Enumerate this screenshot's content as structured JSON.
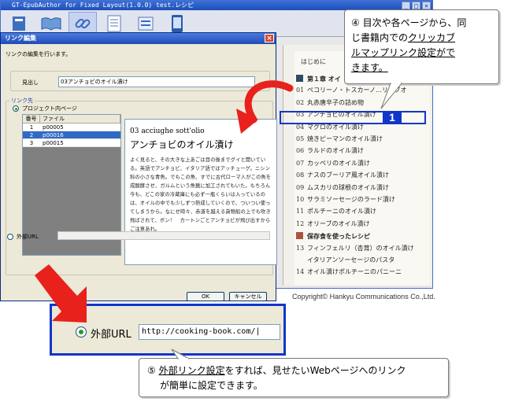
{
  "app": {
    "title": "GT-EpubAuthor for Fixed Layout(1.0.0) test.レシピ",
    "window_buttons": [
      "_",
      "□",
      "×"
    ],
    "toolbar_icons": [
      "book-icon",
      "open-book-icon",
      "link-icon",
      "document-icon",
      "list-icon",
      "device-icon"
    ]
  },
  "toc": {
    "heading": "はじめに",
    "rows": [
      {
        "num": "",
        "label": "第１章 オイ",
        "chapter": true,
        "square": "#2e4a6a"
      },
      {
        "num": "01",
        "label": "ペコリーノ・トスカーノ…リーブオ"
      },
      {
        "num": "02",
        "label": "丸赤唐辛子の詰め物"
      },
      {
        "num": "03",
        "label": "アンチョビのオイル漬け"
      },
      {
        "num": "04",
        "label": "マグロのオイル漬け"
      },
      {
        "num": "05",
        "label": "焼きピーマンのオイル漬け"
      },
      {
        "num": "06",
        "label": "ラルドのオイル漬け"
      },
      {
        "num": "07",
        "label": "カッペリのオイル漬け"
      },
      {
        "num": "08",
        "label": "ナスのブーリア風オイル漬け"
      },
      {
        "num": "09",
        "label": "ムスカリの球根のオイル漬け"
      },
      {
        "num": "10",
        "label": "サラミソーセージのラード漬け"
      },
      {
        "num": "11",
        "label": "ポルチーニのオイル漬け"
      },
      {
        "num": "12",
        "label": "オリーブのオイル漬け"
      },
      {
        "num": "",
        "label": "保存食を使ったレシピ",
        "chapter": true,
        "square": "#a8553a"
      },
      {
        "num": "13",
        "label": "フィンフェルリ（杏茸）のオイル漬け"
      },
      {
        "num": "",
        "label": "イタリアンソーセージのパスタ"
      },
      {
        "num": "14",
        "label": "オイル漬けポルチーニのパニーニ"
      }
    ]
  },
  "highlight": {
    "badge": "1"
  },
  "dialog": {
    "title": "リンク編集",
    "close": "×",
    "description": "リンクの編集を行います。",
    "name_label": "見出し",
    "name_value": "03アンチョビのオイル漬け",
    "link_group_label": "リンク先",
    "internal_radio": "プロジェクト内ページ",
    "table": {
      "headers": [
        "番号",
        "ファイル"
      ],
      "rows": [
        [
          "1",
          "p00005"
        ],
        [
          "2",
          "p00016"
        ],
        [
          "3",
          "p00015"
        ]
      ],
      "selected": 1
    },
    "preview": {
      "number": "03  acciughe sott'olio",
      "title": "アンチョビのオイル漬け",
      "body": "よく見ると、その大きな上あごは目の後までグイと開いている。英語でアンチョビ、イタリア語ではアッチューゲ。ニシン科の小さな青魚。でもこの魚、すでに古代ローマ人がこの魚を成酸酵させ、ガルムという魚醤に加工されてもいた。もちろん今も、どこの家の冷蔵庫にも必ず一瓶くらいは入っているのは、オイルの中でも少しずつ熟成していくので、ついつい使ってしまうから。なにせ時々、赤道を越える貨物船の上でも吹き飛ばされて、ボン！　カートンごとアンチョビが飛び出すからご注意あれ。"
    },
    "external_radio": "外部URL",
    "ok": "OK",
    "cancel": "キャンセル"
  },
  "zoom": {
    "label": "外部URL",
    "url": "http://cooking-book.com/|"
  },
  "copyright": "Copyright© Hankyu Communications Co.,Ltd.",
  "callout_top": {
    "num": "④",
    "line1": "目次や各ページから、同",
    "line2": "じ書籍内での",
    "line2_ul": "クリッカブ",
    "line3_ul": "ルマップリンク設定がで",
    "line4_ul": "きます。"
  },
  "callout_bottom": {
    "num": "⑤",
    "ul": "外部リンク設定",
    "line1": "をすれば、見せたいWebページへのリンク",
    "line2": "が簡単に設定できます。"
  },
  "colors": {
    "accent": "#1236c9",
    "arrow_red": "#e8211c",
    "selection": "#316ac5"
  }
}
